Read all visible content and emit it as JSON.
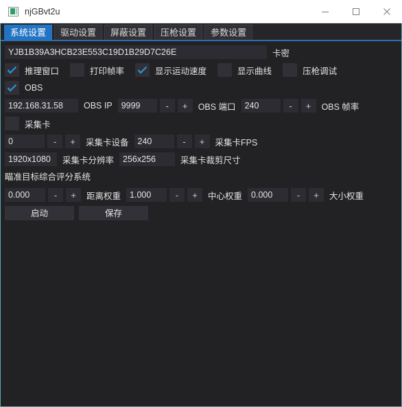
{
  "window": {
    "title": "njGBvt2u",
    "controls": {
      "minimize": "minimize-icon",
      "maximize": "maximize-icon",
      "close": "close-icon"
    },
    "accent_border": "#5ba8b5",
    "background": "#222225"
  },
  "tabs": [
    {
      "label": "系统设置",
      "active": true
    },
    {
      "label": "驱动设置",
      "active": false
    },
    {
      "label": "屏蔽设置",
      "active": false
    },
    {
      "label": "压枪设置",
      "active": false
    },
    {
      "label": "参数设置",
      "active": false
    }
  ],
  "tab_accent": "#2173c4",
  "license": {
    "value": "YJB1B39A3HCB23E553C19D1B29D7C26E",
    "label": "卡密"
  },
  "checkbox_row": [
    {
      "label": "推理窗口",
      "checked": true
    },
    {
      "label": "打印帧率",
      "checked": false
    },
    {
      "label": "显示运动速度",
      "checked": true
    },
    {
      "label": "显示曲线",
      "checked": false
    },
    {
      "label": "压枪调试",
      "checked": false
    }
  ],
  "obs": {
    "enabled": true,
    "enable_label": "OBS",
    "ip": {
      "value": "192.168.31.58",
      "label": "OBS IP"
    },
    "port": {
      "value": "9999",
      "label": "OBS 端口",
      "minus": "-",
      "plus": "+"
    },
    "fps": {
      "value": "240",
      "label": "OBS 帧率",
      "minus": "-",
      "plus": "+"
    }
  },
  "capture_card": {
    "enabled": false,
    "enable_label": "采集卡",
    "device": {
      "value": "0",
      "label": "采集卡设备",
      "minus": "-",
      "plus": "+"
    },
    "fps": {
      "value": "240",
      "label": "采集卡FPS",
      "minus": "-",
      "plus": "+"
    },
    "resolution": {
      "value": "1920x1080",
      "label": "采集卡分辨率"
    },
    "crop_size": {
      "value": "256x256",
      "label": "采集卡裁剪尺寸"
    }
  },
  "scoring": {
    "title": "瞄准目标综合评分系统",
    "distance": {
      "value": "0.000",
      "label": "距离权重",
      "minus": "-",
      "plus": "+"
    },
    "center": {
      "value": "1.000",
      "label": "中心权重",
      "minus": "-",
      "plus": "+"
    },
    "size": {
      "value": "0.000",
      "label": "大小权重",
      "minus": "-",
      "plus": "+"
    }
  },
  "actions": {
    "start": "启动",
    "save": "保存"
  }
}
